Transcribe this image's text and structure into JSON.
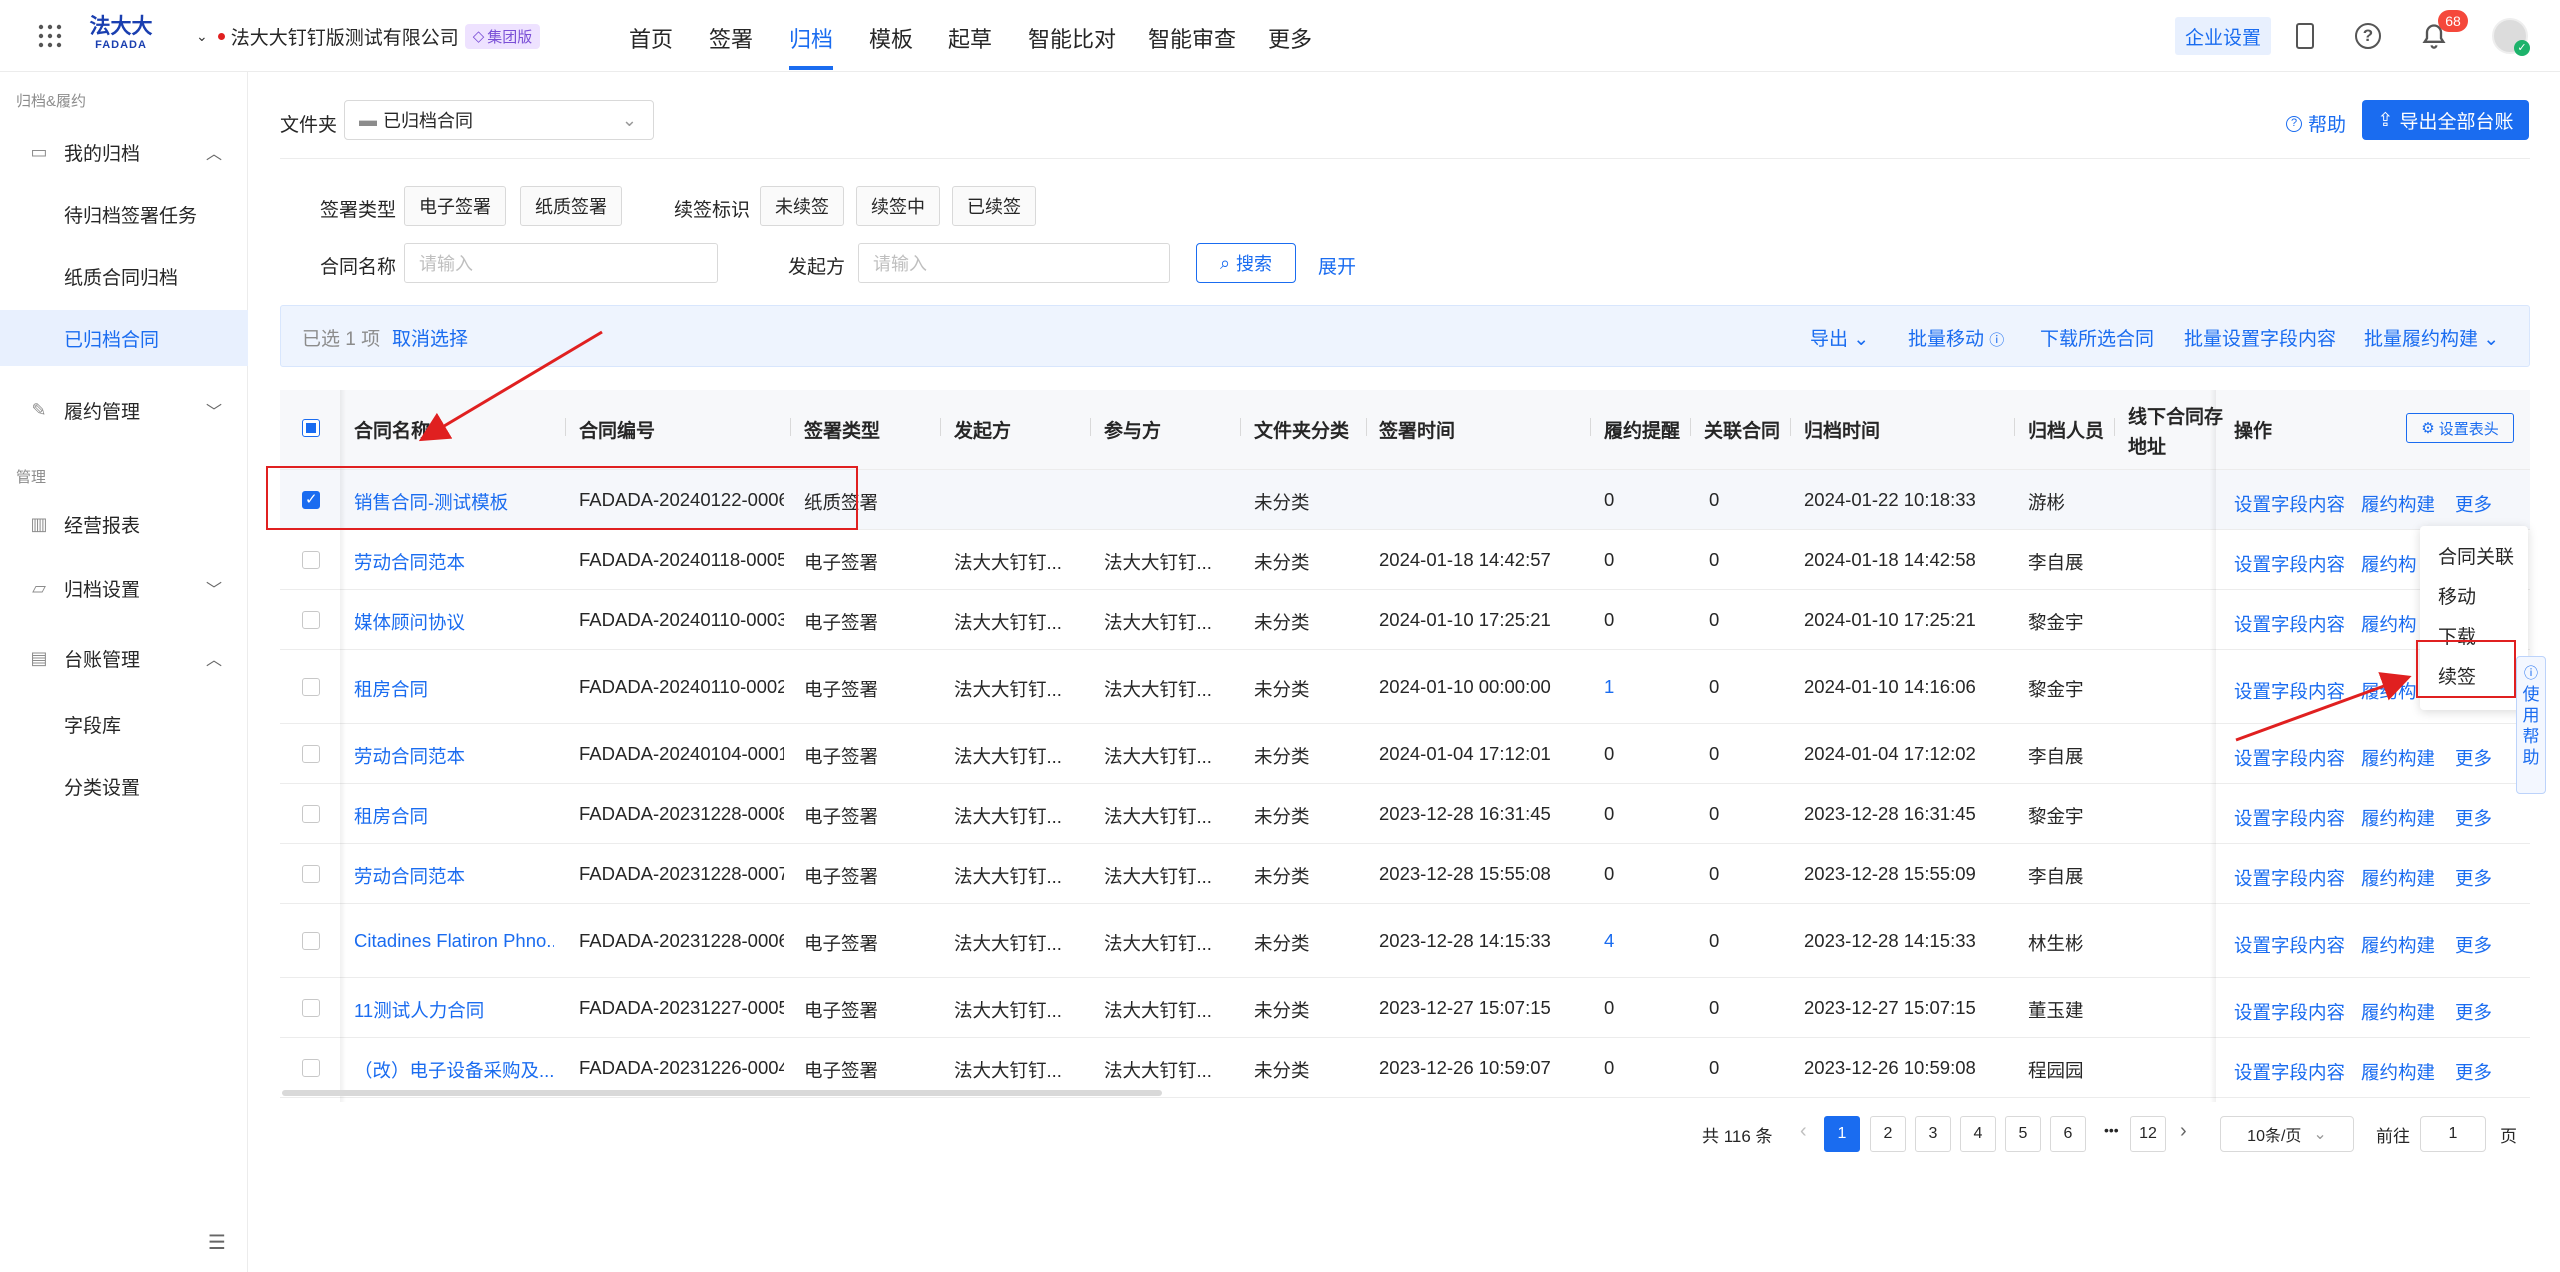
{
  "header": {
    "logo_cn": "法大大",
    "logo_en": "FADADA",
    "company": "法大大钉钉版测试有限公司",
    "edition_badge": "集团版",
    "nav": [
      "首页",
      "签署",
      "归档",
      "模板",
      "起草",
      "智能比对",
      "智能审查",
      "更多"
    ],
    "enterprise_settings": "企业设置",
    "notif_count": "68"
  },
  "sidebar": {
    "group1": "归档&履约",
    "my_archive": "我的归档",
    "pending": "待归档签署任务",
    "paper": "纸质合同归档",
    "archived": "已归档合同",
    "perf_mgmt": "履约管理",
    "group2": "管理",
    "report": "经营报表",
    "archive_settings": "归档设置",
    "ledger_mgmt": "台账管理",
    "field_lib": "字段库",
    "category": "分类设置"
  },
  "filters": {
    "folder_label": "文件夹",
    "folder_value": "已归档合同",
    "help": "帮助",
    "export_all": "导出全部台账",
    "sign_type_label": "签署类型",
    "sign_types": [
      "电子签署",
      "纸质签署"
    ],
    "renew_label": "续签标识",
    "renew_types": [
      "未续签",
      "续签中",
      "已续签"
    ],
    "name_label": "合同名称",
    "name_placeholder": "请输入",
    "initiator_label": "发起方",
    "initiator_placeholder": "请输入",
    "search": "搜索",
    "expand": "展开"
  },
  "toolbar": {
    "selected": "已选 1 项",
    "cancel": "取消选择",
    "export": "导出",
    "batch_move": "批量移动",
    "download_selected": "下载所选合同",
    "batch_set_fields": "批量设置字段内容",
    "batch_perf": "批量履约构建"
  },
  "table": {
    "headers": [
      "合同名称",
      "合同编号",
      "签署类型",
      "发起方",
      "参与方",
      "文件夹分类",
      "签署时间",
      "履约提醒",
      "关联合同",
      "归档时间",
      "归档人员",
      "线下合同存",
      "地址",
      "操作",
      "设置表头"
    ],
    "rows": [
      {
        "name": "销售合同-测试模板",
        "no": "FADADA-20240122-0006",
        "type": "纸质签署",
        "init": "",
        "party": "",
        "folder": "未分类",
        "sign_time": "",
        "remind": "0",
        "related": "0",
        "archive_time": "2024-01-22 10:18:33",
        "person": "游彬"
      },
      {
        "name": "劳动合同范本",
        "no": "FADADA-20240118-0005",
        "type": "电子签署",
        "init": "法大大钉钉...",
        "party": "法大大钉钉...",
        "folder": "未分类",
        "sign_time": "2024-01-18 14:42:57",
        "remind": "0",
        "related": "0",
        "archive_time": "2024-01-18 14:42:58",
        "person": "李自展"
      },
      {
        "name": "媒体顾问协议",
        "no": "FADADA-20240110-0003",
        "type": "电子签署",
        "init": "法大大钉钉...",
        "party": "法大大钉钉...",
        "folder": "未分类",
        "sign_time": "2024-01-10 17:25:21",
        "remind": "0",
        "related": "0",
        "archive_time": "2024-01-10 17:25:21",
        "person": "黎金宇"
      },
      {
        "name": "租房合同",
        "no": "FADADA-20240110-0002",
        "type": "电子签署",
        "init": "法大大钉钉...",
        "party": "法大大钉钉...",
        "folder": "未分类",
        "sign_time": "2024-01-10 00:00:00",
        "remind": "1",
        "related": "0",
        "archive_time": "2024-01-10 14:16:06",
        "person": "黎金宇"
      },
      {
        "name": "劳动合同范本",
        "no": "FADADA-20240104-0001",
        "type": "电子签署",
        "init": "法大大钉钉...",
        "party": "法大大钉钉...",
        "folder": "未分类",
        "sign_time": "2024-01-04 17:12:01",
        "remind": "0",
        "related": "0",
        "archive_time": "2024-01-04 17:12:02",
        "person": "李自展"
      },
      {
        "name": "租房合同",
        "no": "FADADA-20231228-0008",
        "type": "电子签署",
        "init": "法大大钉钉...",
        "party": "法大大钉钉...",
        "folder": "未分类",
        "sign_time": "2023-12-28 16:31:45",
        "remind": "0",
        "related": "0",
        "archive_time": "2023-12-28 16:31:45",
        "person": "黎金宇"
      },
      {
        "name": "劳动合同范本",
        "no": "FADADA-20231228-0007",
        "type": "电子签署",
        "init": "法大大钉钉...",
        "party": "法大大钉钉...",
        "folder": "未分类",
        "sign_time": "2023-12-28 15:55:08",
        "remind": "0",
        "related": "0",
        "archive_time": "2023-12-28 15:55:09",
        "person": "李自展"
      },
      {
        "name": "Citadines Flatiron Phno...",
        "no": "FADADA-20231228-0006",
        "type": "电子签署",
        "init": "法大大钉钉...",
        "party": "法大大钉钉...",
        "folder": "未分类",
        "sign_time": "2023-12-28 14:15:33",
        "remind": "4",
        "related": "0",
        "archive_time": "2023-12-28 14:15:33",
        "person": "林生彬"
      },
      {
        "name": "11测试人力合同",
        "no": "FADADA-20231227-0005",
        "type": "电子签署",
        "init": "法大大钉钉...",
        "party": "法大大钉钉...",
        "folder": "未分类",
        "sign_time": "2023-12-27 15:07:15",
        "remind": "0",
        "related": "0",
        "archive_time": "2023-12-27 15:07:15",
        "person": "董玉建"
      },
      {
        "name": "（改）电子设备采购及...",
        "no": "FADADA-20231226-0004",
        "type": "电子签署",
        "init": "法大大钉钉...",
        "party": "法大大钉钉...",
        "folder": "未分类",
        "sign_time": "2023-12-26 10:59:07",
        "remind": "0",
        "related": "0",
        "archive_time": "2023-12-26 10:59:08",
        "person": "程园园"
      }
    ],
    "ops": [
      "设置字段内容",
      "履约构建",
      "更多"
    ]
  },
  "dropdown": [
    "合同关联",
    "移动",
    "下载",
    "续签"
  ],
  "help_float": [
    "使",
    "用",
    "帮",
    "助"
  ],
  "pagination": {
    "total": "共 116 条",
    "pages": [
      "1",
      "2",
      "3",
      "4",
      "5",
      "6",
      "•••",
      "12"
    ],
    "per_page": "10条/页",
    "goto": "前往",
    "goto_value": "1",
    "page_unit": "页"
  },
  "colors": {
    "accent": "#1a6cf0",
    "annotation": "#e02020"
  }
}
